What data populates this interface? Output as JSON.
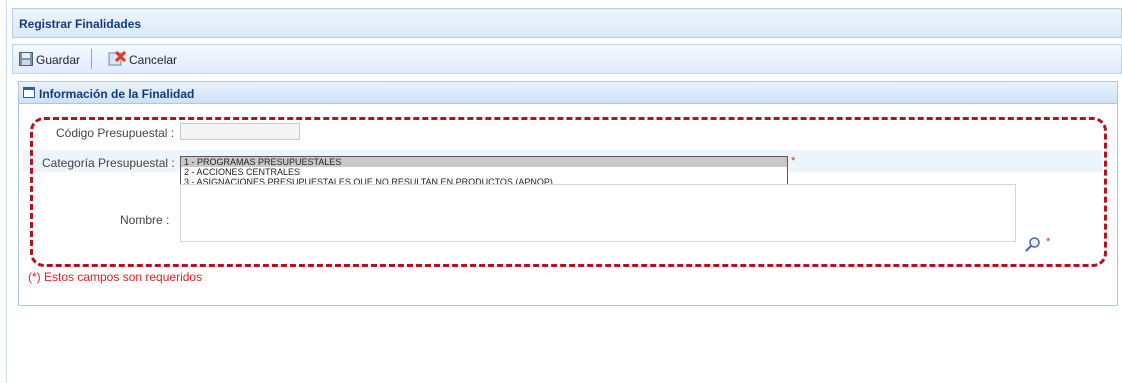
{
  "page": {
    "title": "Registrar Finalidades"
  },
  "toolbar": {
    "save_label": "Guardar",
    "cancel_label": "Cancelar"
  },
  "section": {
    "title": "Información de la Finalidad"
  },
  "form": {
    "codigo_label": "Código Presupuestal :",
    "codigo_value": "",
    "categoria_label": "Categoría Presupuestal :",
    "categoria_options": [
      "1 - PROGRAMAS PRESUPUESTALES",
      "2 - ACCIONES CENTRALES",
      "3 - ASIGNACIONES PRESUPUESTALES QUE NO RESULTAN EN PRODUCTOS (APNOP)"
    ],
    "categoria_selected": "1 - PROGRAMAS PRESUPUESTALES",
    "nombre_label": "Nombre :",
    "nombre_value": "",
    "required_marker": "*"
  },
  "footer": {
    "required_note": "(*) Estos campos son requeridos"
  },
  "colors": {
    "accent": "#0e3d7a",
    "required": "#e02020",
    "highlight_outline": "#b3121f"
  },
  "icons": [
    "save-icon",
    "cancel-icon",
    "window-icon",
    "search-icon",
    "scroll-up-icon",
    "scroll-down-icon"
  ]
}
